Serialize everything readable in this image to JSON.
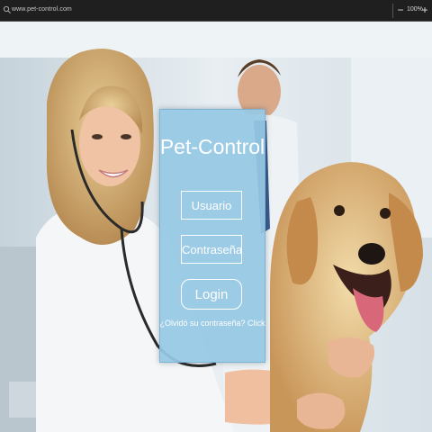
{
  "browser": {
    "url": "www.pet-control.com",
    "zoom_out": "−",
    "zoom_level": "100%",
    "zoom_in": "+"
  },
  "login": {
    "title": "Pet-Control",
    "username_placeholder": "Usuario",
    "password_placeholder": "Contraseña",
    "button_label": "Login",
    "forgot_link": "¿Olvidó su contraseña? Click"
  },
  "colors": {
    "panel": "#96c8e4",
    "browser_bar": "#1f1f1f",
    "text": "#ffffff"
  },
  "icons": {
    "search": "search-icon"
  }
}
